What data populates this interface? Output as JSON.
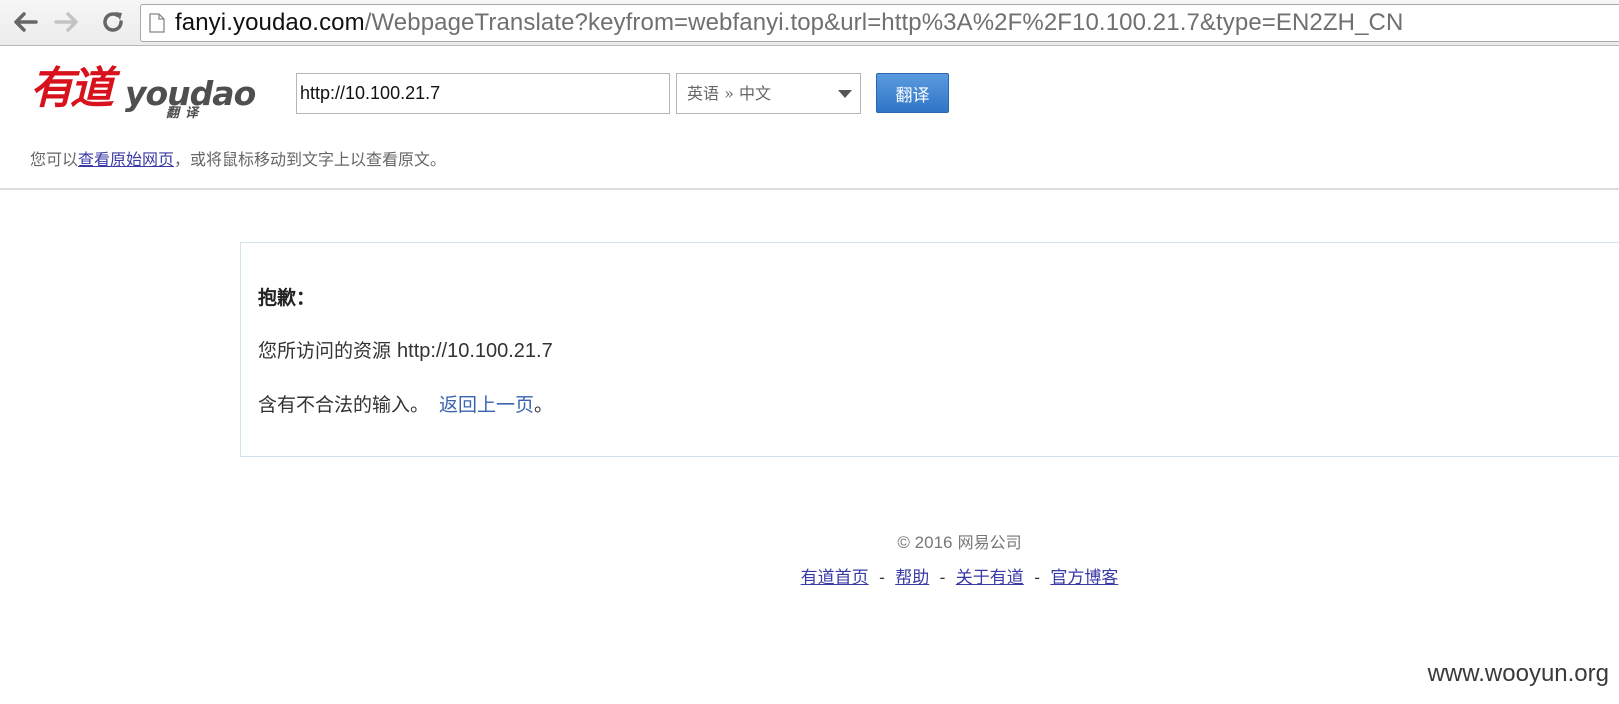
{
  "browser": {
    "url_host": "fanyi.youdao.com",
    "url_rest": "/WebpageTranslate?keyfrom=webfanyi.top&url=http%3A%2F%2F10.100.21.7&type=EN2ZH_CN"
  },
  "header": {
    "logo_cn": "有道",
    "logo_en": "youdao",
    "logo_sub": "翻译",
    "url_value": "http://10.100.21.7",
    "lang_select": "英语 » 中文",
    "translate_button": "翻译",
    "hint_prefix": "您可以",
    "hint_link": "查看原始网页",
    "hint_suffix": "，或将鼠标移动到文字上以查看原文。"
  },
  "content": {
    "title": "抱歉：",
    "line1_text": "您所访问的资源 ",
    "line1_url": "http://10.100.21.7",
    "line2_text": "含有不合法的输入。",
    "back_link": "返回上一页",
    "line2_end": "。"
  },
  "footer": {
    "copyright_year": "© 2016",
    "copyright_company": " 网易公司",
    "links": [
      "有道首页",
      "帮助",
      "关于有道",
      "官方博客"
    ],
    "separator": "-"
  },
  "watermark": "www.wooyun.org",
  "colors": {
    "brand_red": "#d8121c",
    "button_blue": "#2f75c6",
    "link": "#3a3aa6"
  }
}
